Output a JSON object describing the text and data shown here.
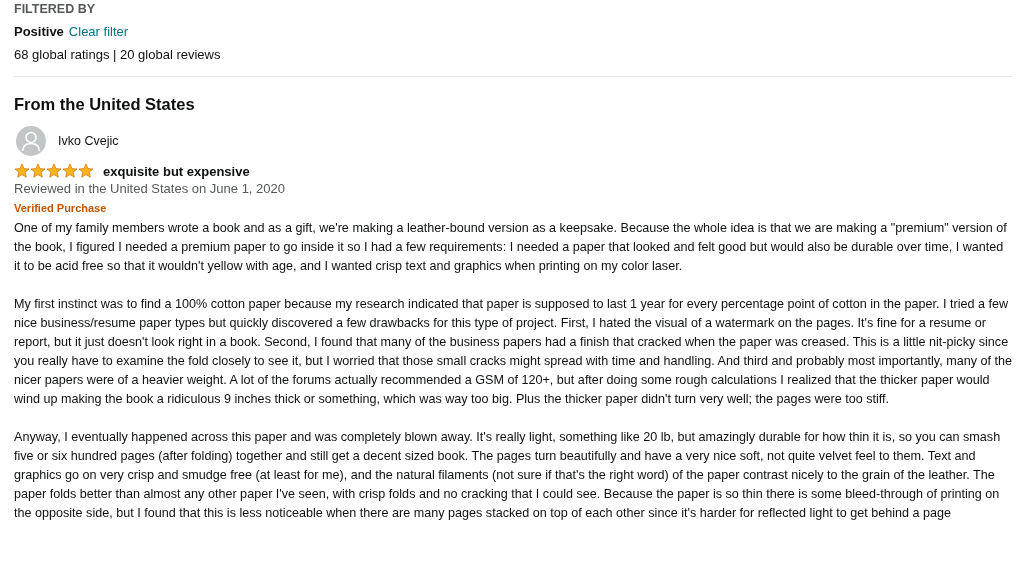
{
  "filter": {
    "heading": "FILTERED BY",
    "value": "Positive",
    "clear_link": "Clear filter",
    "counts": "68 global ratings | 20 global reviews"
  },
  "section_title": "From the United States",
  "reviews": [
    {
      "author": "Ivko Cvejic",
      "stars": 5,
      "title": "exquisite but expensive",
      "date": "Reviewed in the United States on June 1, 2020",
      "badge": "Verified Purchase",
      "paragraphs": [
        "One of my family members wrote a book and as a gift, we're making a leather-bound version as a keepsake. Because the whole idea is that we are making a \"premium\" version of the book, I figured I needed a premium paper to go inside it so I had a few requirements: I needed a paper that looked and felt good but would also be durable over time, I wanted it to be acid free so that it wouldn't yellow with age, and I wanted crisp text and graphics when printing on my color laser.",
        "My first instinct was to find a 100% cotton paper because my research indicated that paper is supposed to last 1 year for every percentage point of cotton in the paper. I tried a few nice business/resume paper types but quickly discovered a few drawbacks for this type of project. First, I hated the visual of a watermark on the pages. It's fine for a resume or report, but it just doesn't look right in a book. Second, I found that many of the business papers had a finish that cracked when the paper was creased. This is a little nit-picky since you really have to examine the fold closely to see it, but I worried that those small cracks might spread with time and handling. And third and probably most importantly, many of the nicer papers were of a heavier weight. A lot of the forums actually recommended a GSM of 120+, but after doing some rough calculations I realized that the thicker paper would wind up making the book a ridiculous 9 inches thick or something, which was way too big. Plus the thicker paper didn't turn very well; the pages were too stiff.",
        "Anyway, I eventually happened across this paper and was completely blown away. It's really light, something like 20 lb, but amazingly durable for how thin it is, so you can smash five or six hundred pages (after folding) together and still get a decent sized book. The pages turn beautifully and have a very nice soft, not quite velvet feel to them. Text and graphics go on very crisp and smudge free (at least for me), and the natural filaments (not sure if that's the right word) of the paper contrast nicely to the grain of the leather. The paper folds better than almost any other paper I've seen, with crisp folds and no cracking that I could see. Because the paper is so thin there is some bleed-through of printing on the opposite side, but I found that this is less noticeable when there are many pages stacked on top of each other since it's harder for reflected light to get behind a page"
      ]
    }
  ]
}
